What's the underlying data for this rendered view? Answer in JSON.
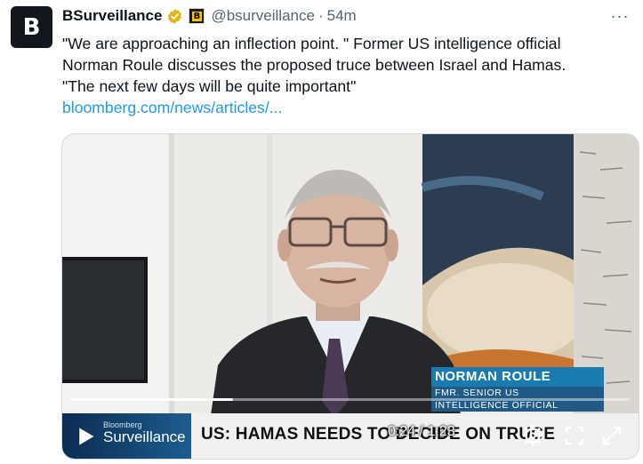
{
  "tweet": {
    "avatar_letter": "B",
    "display_name": "BSurveillance",
    "handle": "@bsurveillance",
    "separator": "·",
    "time": "54m",
    "more_label": "···",
    "text_line1": "\"We are approaching an inflection point. \" Former US intelligence official",
    "text_line2": "Norman Roule discusses the proposed truce between Israel and Hamas.",
    "text_line3": "\"The next few days will be quite important\"",
    "link": "bloomberg.com/news/articles/..."
  },
  "video": {
    "lower_third_name": "NORMAN ROULE",
    "lower_third_title_line1": "FMR. SENIOR US",
    "lower_third_title_line2": "INTELLIGENCE OFFICIAL",
    "brand_small": "Bloomberg",
    "brand_big": "Surveillance",
    "headline": "US: HAMAS NEEDS TO DECIDE ON TRUCE",
    "timecode": "0:24 / 1:23",
    "progress": 0.29
  },
  "colors": {
    "link": "#1d9bf0",
    "muted": "#536471",
    "verified_gold": "#e2b719",
    "lower_third_blue": "#1a7bb0"
  },
  "icons": {
    "verified": "verified-badge-icon",
    "affiliate": "affiliate-badge-icon",
    "more": "more-icon",
    "play": "play-icon",
    "settings": "settings-icon",
    "fullscreen": "fullscreen-icon",
    "expand": "expand-icon"
  }
}
